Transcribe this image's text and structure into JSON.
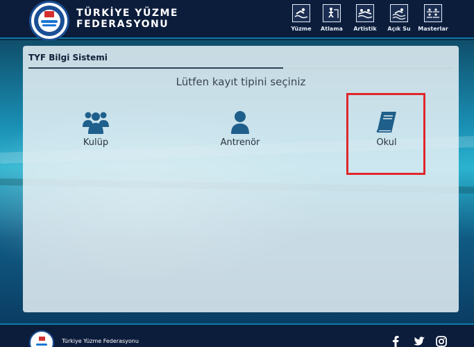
{
  "header": {
    "brand_line1": "TÜRKİYE YÜZME",
    "brand_line2": "FEDERASYONU",
    "disciplines": [
      {
        "label": "Yüzme",
        "icon": "swimming-icon"
      },
      {
        "label": "Atlama",
        "icon": "diving-icon"
      },
      {
        "label": "Artistik",
        "icon": "artistic-swimming-icon"
      },
      {
        "label": "Açık Su",
        "icon": "open-water-icon"
      },
      {
        "label": "Masterlar",
        "icon": "masters-icon"
      }
    ]
  },
  "panel": {
    "system_title": "TYF Bilgi Sistemi",
    "prompt": "Lütfen kayıt tipini seçiniz",
    "choices": [
      {
        "label": "Kulüp",
        "icon": "group-icon"
      },
      {
        "label": "Antrenör",
        "icon": "user-icon"
      },
      {
        "label": "Okul",
        "icon": "book-icon"
      }
    ],
    "highlighted_choice": "Okul",
    "highlight_color": "#e0262b"
  },
  "footer": {
    "text": "Türkiye Yüzme Federasyonu",
    "social": [
      "facebook-icon",
      "twitter-icon",
      "instagram-icon"
    ]
  },
  "colors": {
    "header_bg": "#0c1d3c",
    "icon_blue": "#1f5f8b"
  }
}
